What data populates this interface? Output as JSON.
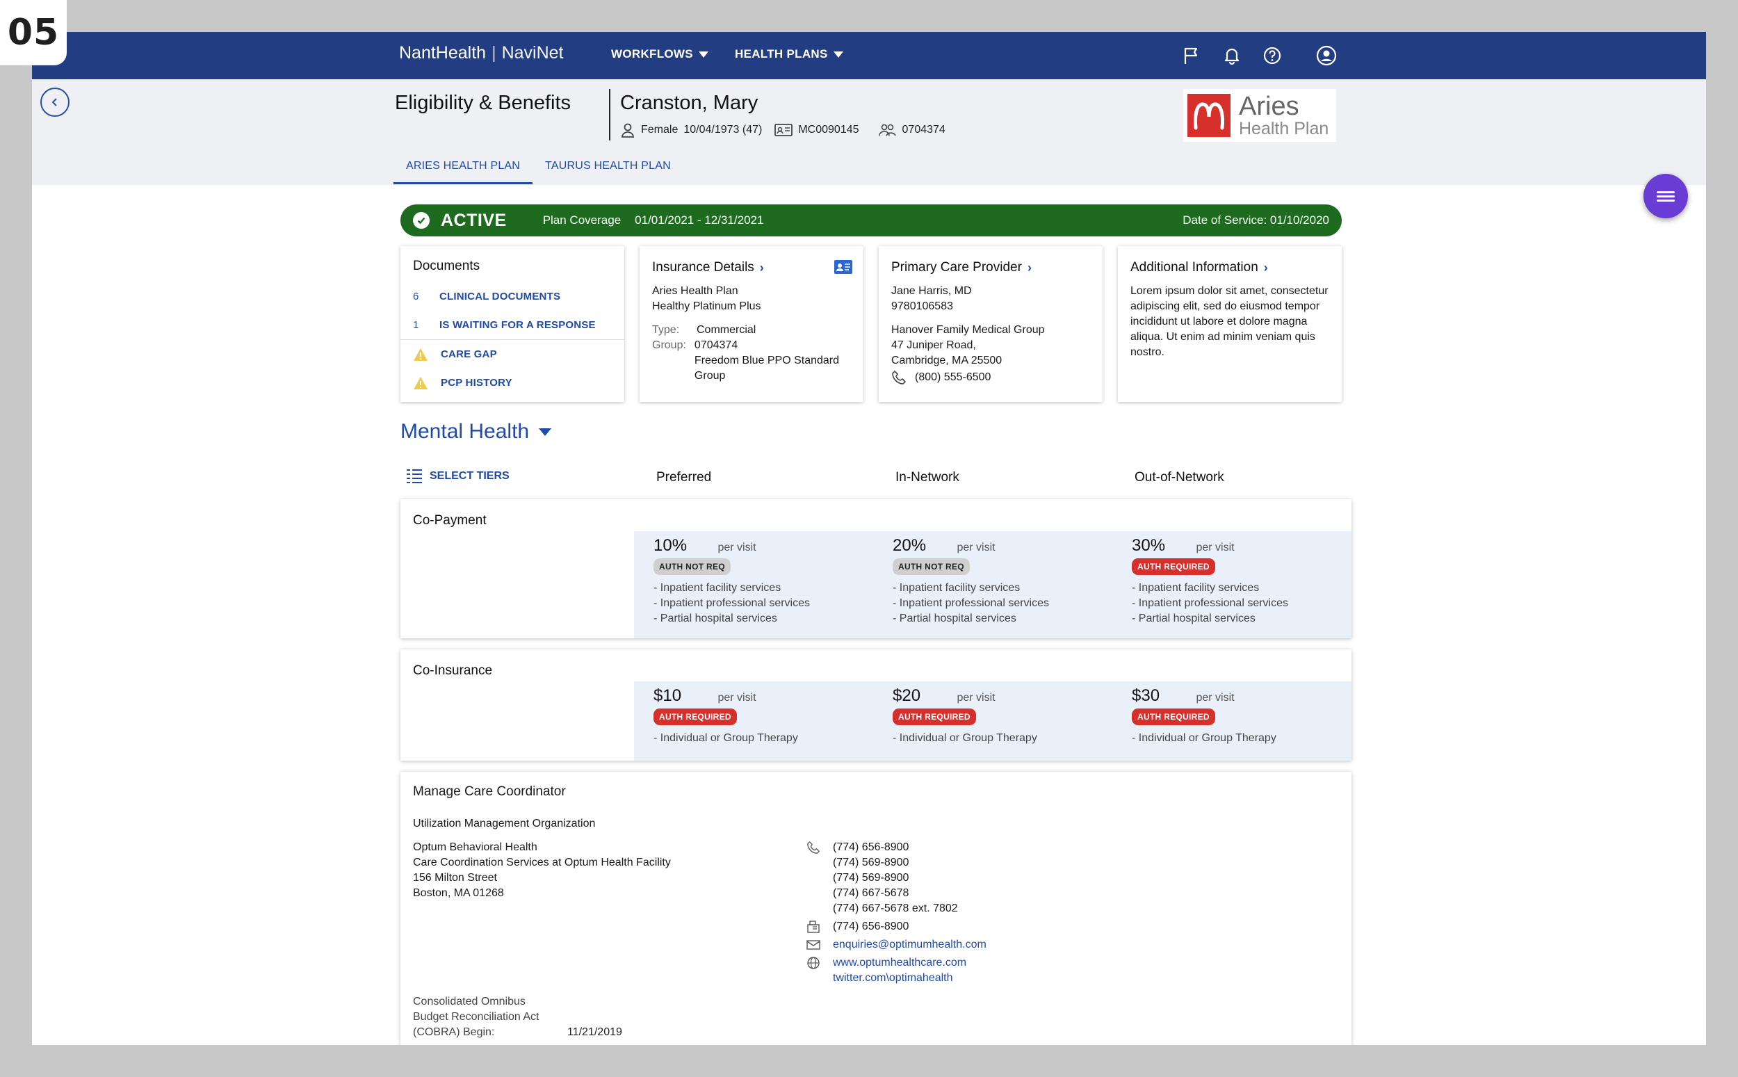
{
  "slide_number": "05",
  "nav": {
    "brand_name": "NantHealth",
    "brand_product": "NaviNet",
    "menus": [
      "WORKFLOWS",
      "HEALTH PLANS"
    ],
    "icons": [
      "flag-icon",
      "bell-icon",
      "help-icon",
      "account-icon"
    ]
  },
  "header": {
    "page_title": "Eligibility & Benefits",
    "patient_name": "Cranston, Mary",
    "gender": "Female",
    "dob": "10/04/1973 (47)",
    "member_id": "MC0090145",
    "group_id": "0704374",
    "logo": {
      "line1": "Aries",
      "line2": "Health Plan"
    },
    "tabs": [
      {
        "label": "ARIES HEALTH PLAN",
        "active": true
      },
      {
        "label": "TAURUS HEALTH PLAN",
        "active": false
      }
    ]
  },
  "status": {
    "label": "ACTIVE",
    "coverage_label": "Plan Coverage",
    "coverage_range": "01/01/2021 - 12/31/2021",
    "date_of_service": "Date of Service: 01/10/2020",
    "color": "#1e6b1f"
  },
  "documents": {
    "title": "Documents",
    "rows": [
      {
        "count": "6",
        "label": "CLINICAL DOCUMENTS"
      },
      {
        "count": "1",
        "label": "IS WAITING FOR A RESPONSE"
      }
    ],
    "alerts": [
      "CARE GAP",
      "PCP HISTORY"
    ]
  },
  "insurance": {
    "title": "Insurance Details",
    "plan": "Aries Health Plan",
    "product": "Healthy Platinum Plus",
    "type_key": "Type:",
    "type_val": "Commercial",
    "group_key": "Group:",
    "group_val": "0704374",
    "group_name": "Freedom Blue PPO Standard Group"
  },
  "pcp": {
    "title": "Primary Care Provider",
    "name": "Jane Harris, MD",
    "npi": "9780106583",
    "practice": "Hanover Family Medical Group",
    "address1": "47 Juniper Road,",
    "address2": "Cambridge, MA 25500",
    "phone": "(800) 555-6500"
  },
  "additional": {
    "title": "Additional Information",
    "text": "Lorem ipsum dolor sit amet, consectetur adipiscing elit, sed do eiusmod tempor incididunt ut labore et dolore magna aliqua. Ut enim ad minim veniam quis nostro."
  },
  "benefits": {
    "section": "Mental Health",
    "select_tiers": "SELECT TIERS",
    "tiers": [
      "Preferred",
      "In-Network",
      "Out-of-Network"
    ],
    "copay": {
      "label": "Co-Payment",
      "cells": [
        {
          "value": "10%",
          "unit": "per visit",
          "auth": "AUTH NOT REQ",
          "auth_type": "gray",
          "items": [
            "Inpatient facility services",
            "Inpatient professional services",
            "Partial hospital services"
          ]
        },
        {
          "value": "20%",
          "unit": "per visit",
          "auth": "AUTH NOT REQ",
          "auth_type": "gray",
          "items": [
            "Inpatient facility services",
            "Inpatient professional  services",
            "Partial hospital services"
          ]
        },
        {
          "value": "30%",
          "unit": "per visit",
          "auth": "AUTH REQUIRED",
          "auth_type": "red",
          "items": [
            "Inpatient facility services",
            "Inpatient professional services",
            "Partial hospital services"
          ]
        }
      ]
    },
    "coins": {
      "label": "Co-Insurance",
      "cells": [
        {
          "value": "$10",
          "unit": "per visit",
          "auth": "AUTH REQUIRED",
          "note": "- Individual or Group Therapy"
        },
        {
          "value": "$20",
          "unit": "per visit",
          "auth": "AUTH REQUIRED",
          "note": "- Individual or Group Therapy"
        },
        {
          "value": "$30",
          "unit": "per visit",
          "auth": "AUTH REQUIRED",
          "note": "- Individual or Group Therapy"
        }
      ]
    }
  },
  "care_coordinator": {
    "title": "Manage Care Coordinator",
    "umo": "Utilization Management Organization",
    "address": [
      "Optum Behavioral Health",
      "Care Coordination Services at Optum Health Facility",
      "156 Milton Street",
      "Boston, MA 01268"
    ],
    "phones": [
      "(774) 656-8900",
      "(774) 569-8900",
      "(774) 569-8900",
      "(774) 667-5678",
      "(774) 667-5678 ext. 7802"
    ],
    "fax": "(774) 656-8900",
    "email": "enquiries@optimumhealth.com",
    "web": "www.optumhealthcare.com",
    "twitter": "twitter.com\\optimahealth",
    "cobra_lines": [
      "Consolidated Omnibus",
      "Budget  Reconciliation Act",
      "(COBRA) Begin:"
    ],
    "cobra_date": "11/21/2019"
  }
}
